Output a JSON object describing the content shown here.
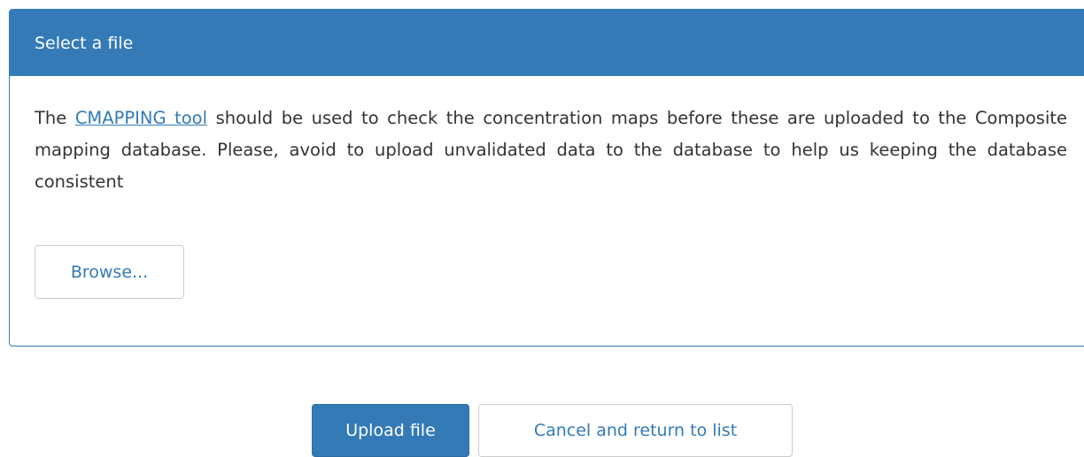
{
  "panel": {
    "title": "Select a file",
    "description": {
      "prefix": "The ",
      "link_text": "CMAPPING tool",
      "suffix": " should be used to check the concentration maps before these are uploaded to the Composite mapping database. Please, avoid to upload unvalidated data to the database to help us keeping the database consistent"
    },
    "browse_label": "Browse..."
  },
  "actions": {
    "upload_label": "Upload file",
    "cancel_label": "Cancel and return to list"
  },
  "colors": {
    "primary": "#337ab7",
    "text": "#333333",
    "border": "#cccccc"
  }
}
